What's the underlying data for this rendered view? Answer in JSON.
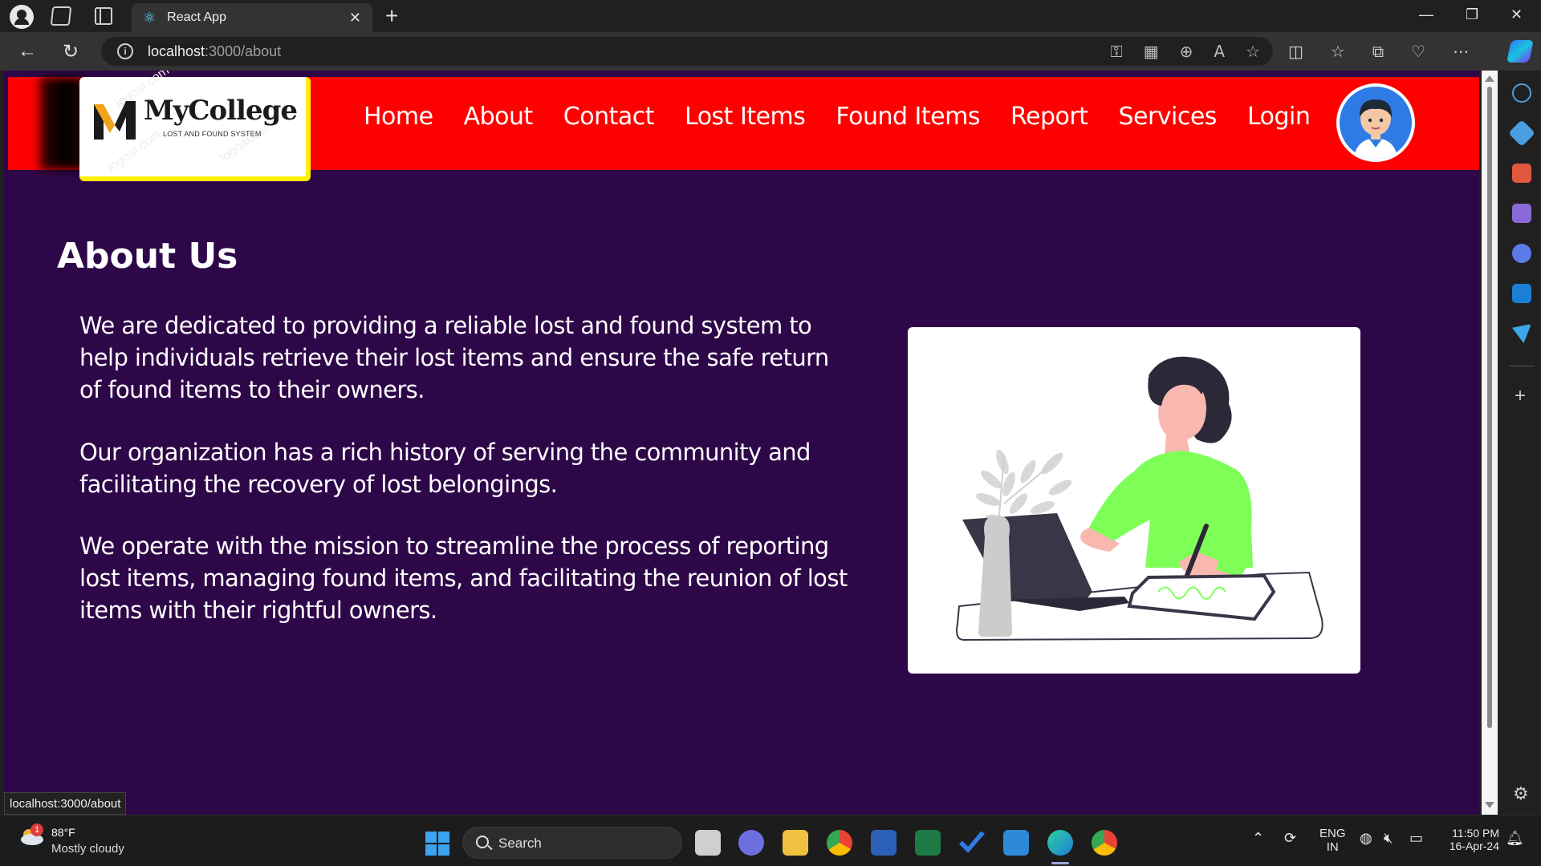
{
  "browser": {
    "tab_title": "React App",
    "url_host": "localhost",
    "url_path": ":3000/about",
    "status_url": "localhost:3000/about"
  },
  "navbar": {
    "logo_title": "MyCollege",
    "logo_subtitle": "LOST AND FOUND SYSTEM",
    "logo_watermark": "logoai.com",
    "links": [
      "Home",
      "About",
      "Contact",
      "Lost Items",
      "Found Items",
      "Report",
      "Services",
      "Login"
    ]
  },
  "main": {
    "title": "About Us",
    "paragraphs": [
      "We are dedicated to providing a reliable lost and found system to help individuals retrieve their lost items and ensure the safe return of found items to their owners.",
      "Our organization has a rich history of serving the community and facilitating the recovery of lost belongings.",
      "We operate with the mission to streamline the process of reporting lost items, managing found items, and facilitating the reunion of lost items with their rightful owners."
    ]
  },
  "colors": {
    "navbar_bg": "#ff0000",
    "page_bg": "#2e0749",
    "logo_border": "#ffef00",
    "avatar_bg": "#2f7be6",
    "illustration_shirt": "#7dff57"
  },
  "taskbar": {
    "weather_badge": "1",
    "temperature": "88°F",
    "condition": "Mostly cloudy",
    "search_label": "Search",
    "lang_top": "ENG",
    "lang_bottom": "IN",
    "time": "11:50 PM",
    "date": "16-Apr-24"
  }
}
